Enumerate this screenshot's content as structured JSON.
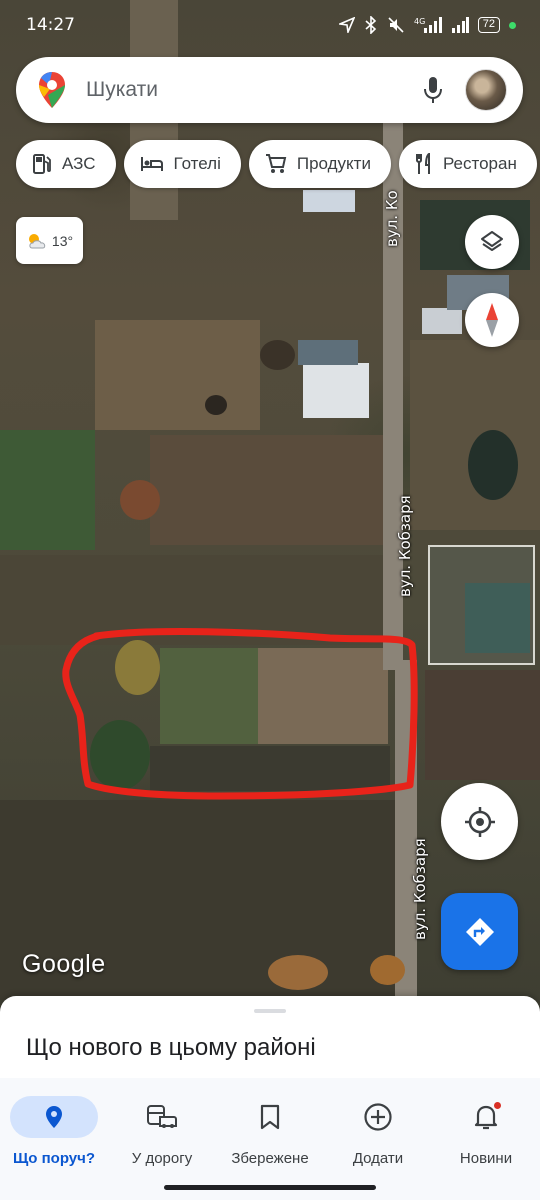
{
  "status_bar": {
    "time": "14:27",
    "battery": "72",
    "network": "4G"
  },
  "search": {
    "placeholder": "Шукати"
  },
  "chips": [
    {
      "icon": "gas-station-icon",
      "label": "АЗС"
    },
    {
      "icon": "hotel-bed-icon",
      "label": "Готелі"
    },
    {
      "icon": "cart-icon",
      "label": "Продукти"
    },
    {
      "icon": "restaurant-icon",
      "label": "Ресторан"
    }
  ],
  "weather": {
    "temp": "13°",
    "icon": "partly-cloudy-icon"
  },
  "map": {
    "street_labels": [
      "вул. Кобзаря",
      "вул. Кобзаря",
      "вул. Ко"
    ],
    "attribution": "Google",
    "outline_color": "#e8231a"
  },
  "sheet": {
    "title": "Що нового в цьому районі"
  },
  "nav": [
    {
      "icon": "location-pin-icon",
      "label": "Що поруч?",
      "active": true
    },
    {
      "icon": "commute-icon",
      "label": "У дорогу",
      "active": false
    },
    {
      "icon": "bookmark-icon",
      "label": "Збережене",
      "active": false
    },
    {
      "icon": "add-circle-icon",
      "label": "Додати",
      "active": false
    },
    {
      "icon": "bell-icon",
      "label": "Новини",
      "active": false,
      "badge": true
    }
  ],
  "colors": {
    "accent": "#1a73e8",
    "nav_active_bg": "#d3e3fd",
    "nav_active_text": "#0b57d0"
  }
}
